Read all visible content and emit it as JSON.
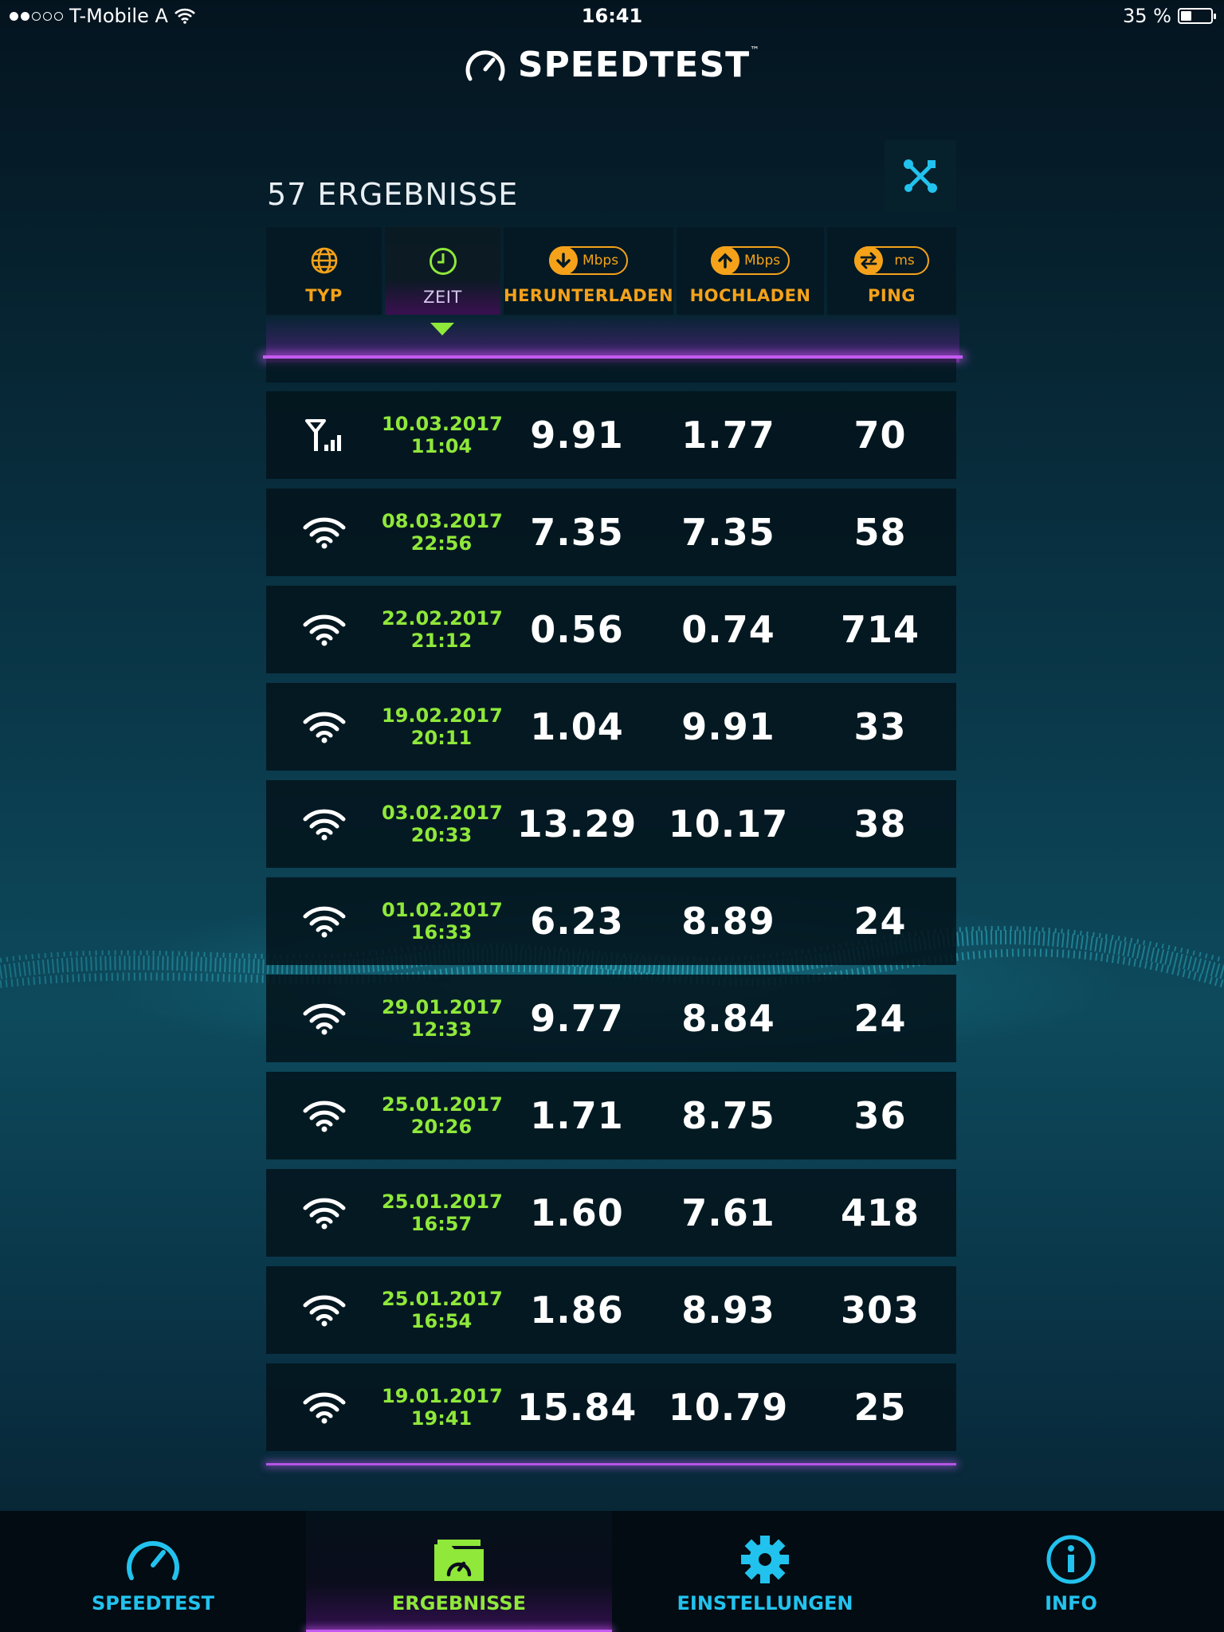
{
  "status_bar": {
    "carrier": "T-Mobile A",
    "time": "16:41",
    "battery": "35 %",
    "battery_level": 0.35
  },
  "app": {
    "logo_text": "SPEEDTEST",
    "trademark": "™"
  },
  "results": {
    "count_label": "57 ERGEBNISSE"
  },
  "columns": {
    "type": "TYP",
    "time": "ZEIT",
    "download": "HERUNTERLADEN",
    "download_unit": "Mbps",
    "upload": "HOCHLADEN",
    "upload_unit": "Mbps",
    "ping": "PING",
    "ping_unit": "ms",
    "sorted_by": "time"
  },
  "rows": [
    {
      "connection": "cellular",
      "date": "10.03.2017",
      "time": "11:04",
      "download": "9.91",
      "upload": "1.77",
      "ping": "70"
    },
    {
      "connection": "wifi",
      "date": "08.03.2017",
      "time": "22:56",
      "download": "7.35",
      "upload": "7.35",
      "ping": "58"
    },
    {
      "connection": "wifi",
      "date": "22.02.2017",
      "time": "21:12",
      "download": "0.56",
      "upload": "0.74",
      "ping": "714"
    },
    {
      "connection": "wifi",
      "date": "19.02.2017",
      "time": "20:11",
      "download": "1.04",
      "upload": "9.91",
      "ping": "33"
    },
    {
      "connection": "wifi",
      "date": "03.02.2017",
      "time": "20:33",
      "download": "13.29",
      "upload": "10.17",
      "ping": "38"
    },
    {
      "connection": "wifi",
      "date": "01.02.2017",
      "time": "16:33",
      "download": "6.23",
      "upload": "8.89",
      "ping": "24"
    },
    {
      "connection": "wifi",
      "date": "29.01.2017",
      "time": "12:33",
      "download": "9.77",
      "upload": "8.84",
      "ping": "24"
    },
    {
      "connection": "wifi",
      "date": "25.01.2017",
      "time": "20:26",
      "download": "1.71",
      "upload": "8.75",
      "ping": "36"
    },
    {
      "connection": "wifi",
      "date": "25.01.2017",
      "time": "16:57",
      "download": "1.60",
      "upload": "7.61",
      "ping": "418"
    },
    {
      "connection": "wifi",
      "date": "25.01.2017",
      "time": "16:54",
      "download": "1.86",
      "upload": "8.93",
      "ping": "303"
    },
    {
      "connection": "wifi",
      "date": "19.01.2017",
      "time": "19:41",
      "download": "15.84",
      "upload": "10.79",
      "ping": "25"
    }
  ],
  "tabs": [
    {
      "label": "SPEEDTEST",
      "icon": "speedometer-icon",
      "active": false
    },
    {
      "label": "ERGEBNISSE",
      "icon": "results-folder-icon",
      "active": true
    },
    {
      "label": "EINSTELLUNGEN",
      "icon": "gear-icon",
      "active": false
    },
    {
      "label": "INFO",
      "icon": "info-icon",
      "active": false
    }
  ],
  "colors": {
    "accent_green": "#8fe83a",
    "accent_orange": "#f5a21a",
    "accent_cyan": "#22c2ee",
    "accent_purple": "#c45bf0"
  }
}
